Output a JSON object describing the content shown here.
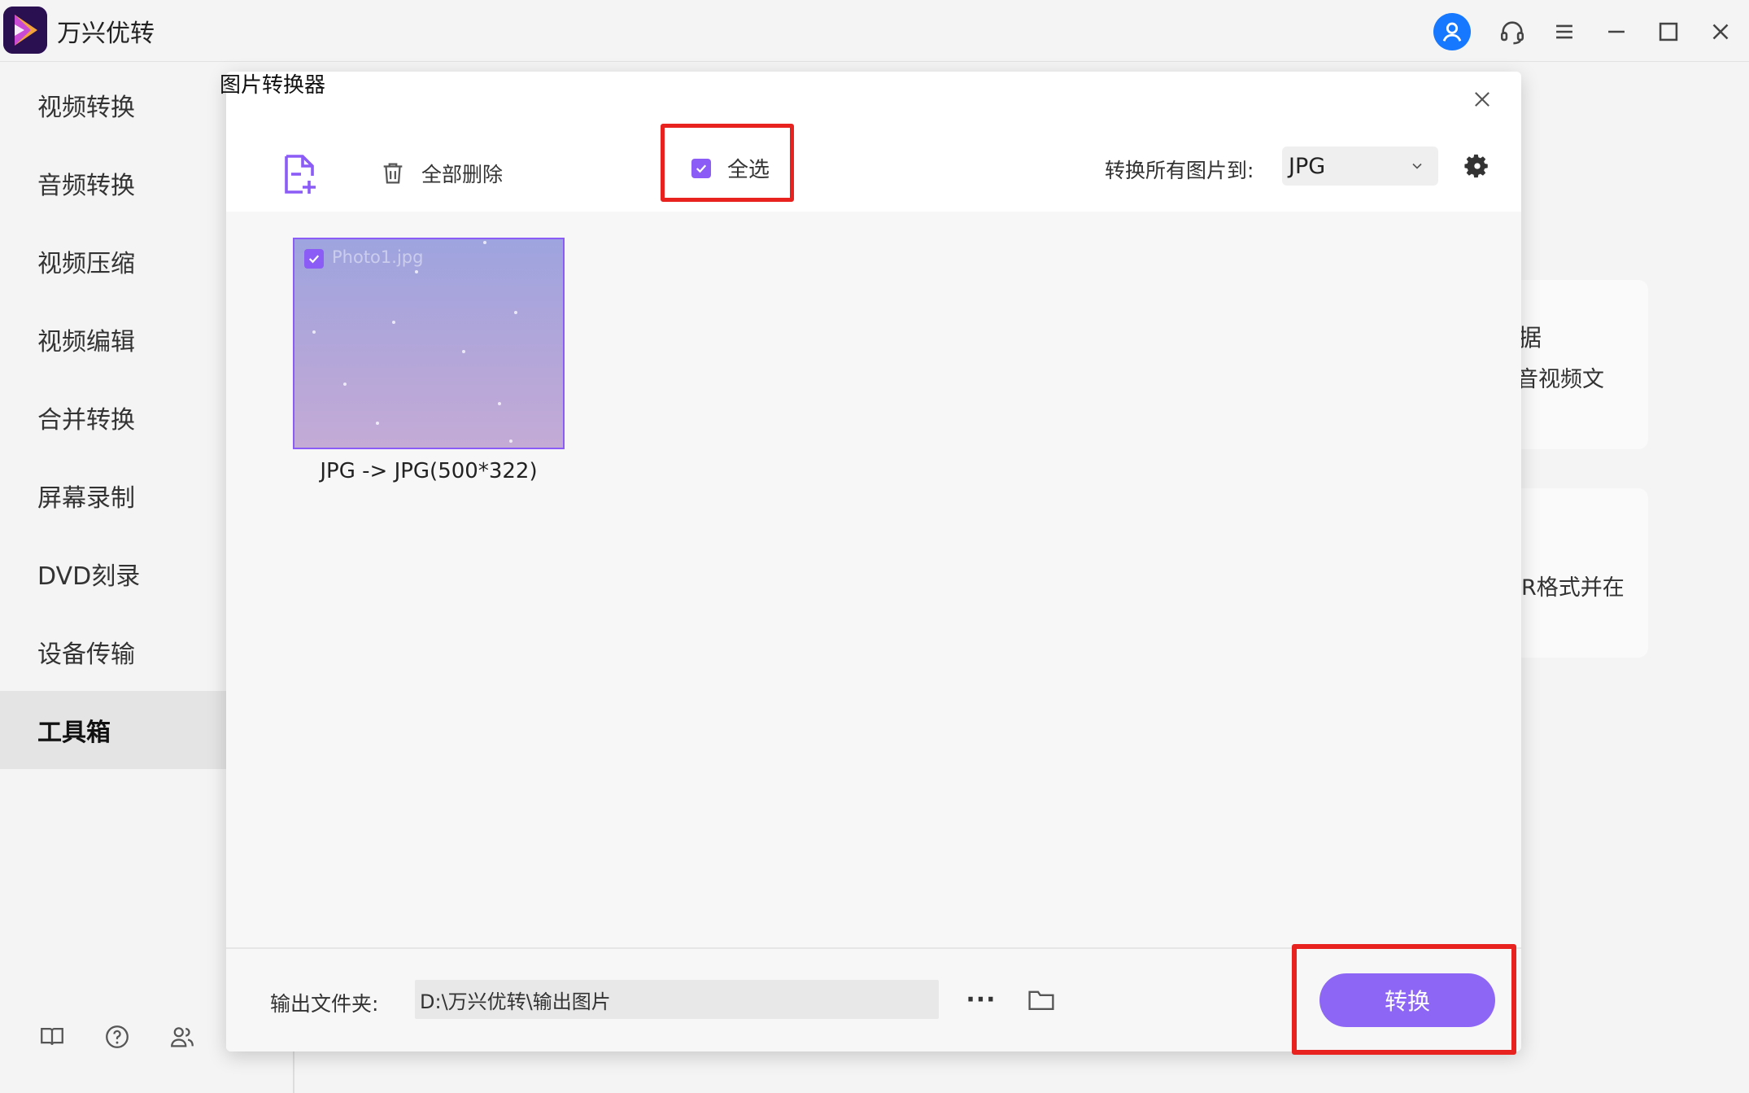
{
  "app": {
    "title": "万兴优转",
    "logo_icon": "app-logo-icon"
  },
  "titlebar": {
    "icons": [
      "user-icon",
      "headset-icon",
      "menu-icon",
      "minimize-icon",
      "maximize-icon",
      "close-icon"
    ],
    "accent": "#1677ff"
  },
  "sidebar": {
    "items": [
      {
        "label": "视频转换"
      },
      {
        "label": "音频转换"
      },
      {
        "label": "视频压缩"
      },
      {
        "label": "视频编辑"
      },
      {
        "label": "合并转换"
      },
      {
        "label": "屏幕录制"
      },
      {
        "label": "DVD刻录"
      },
      {
        "label": "设备传输"
      },
      {
        "label": "工具箱",
        "active": true
      }
    ],
    "footer_icons": [
      "book-icon",
      "help-icon",
      "user-group-icon"
    ]
  },
  "background": {
    "card1_title": "据",
    "card1_desc": "音视频文",
    "card2_desc": "R格式并在"
  },
  "dialog": {
    "title": "图片转换器",
    "toolbar": {
      "add_file_icon": "add-file-icon",
      "delete_all_label": "全部删除",
      "select_all_label": "全选",
      "select_all_checked": true,
      "convert_all_label": "转换所有图片到:",
      "format_value": "JPG"
    },
    "files": [
      {
        "name": "Photo1.jpg",
        "caption": "JPG -> JPG(500*322)",
        "checked": true
      }
    ],
    "footer": {
      "output_label": "输出文件夹:",
      "output_path": "D:\\万兴优转\\输出图片",
      "more_label": "···",
      "convert_label": "转换"
    },
    "colors": {
      "accent": "#8b5cf6",
      "button": "#8e66f6",
      "highlight": "#e8231f"
    }
  }
}
